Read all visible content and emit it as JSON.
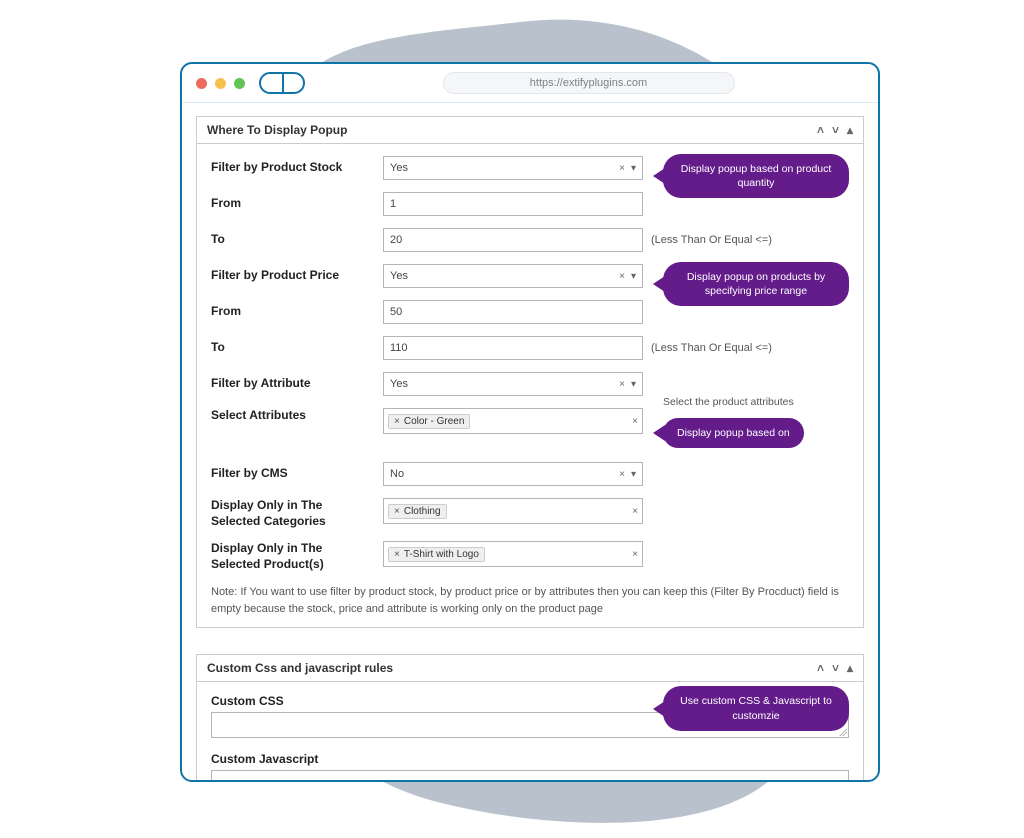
{
  "window": {
    "url": "https://extifyplugins.com"
  },
  "panel1": {
    "title": "Where To Display Popup",
    "rows": {
      "stock_filter": {
        "label": "Filter by Product Stock",
        "value": "Yes"
      },
      "stock_from": {
        "label": "From",
        "value": "1"
      },
      "stock_to": {
        "label": "To",
        "value": "20",
        "suffix": "(Less Than Or Equal <=)"
      },
      "price_filter": {
        "label": "Filter by Product Price",
        "value": "Yes"
      },
      "price_from": {
        "label": "From",
        "value": "50"
      },
      "price_to": {
        "label": "To",
        "value": "110",
        "suffix": "(Less Than Or Equal <=)"
      },
      "attr_filter": {
        "label": "Filter by Attribute",
        "value": "Yes"
      },
      "attr_select": {
        "label": "Select Attributes",
        "tag": "Color - Green",
        "side_hint": "Select the product attributes"
      },
      "cms_filter": {
        "label": "Filter by CMS",
        "value": "No"
      },
      "cat_only": {
        "label": "Display Only in The Selected Categories",
        "tag": "Clothing"
      },
      "prod_only": {
        "label": "Display Only in The Selected Product(s)",
        "tag": "T-Shirt with Logo"
      }
    },
    "note": "Note: If You want to use filter by product stock, by product price or by attributes then you can keep this (Filter By Procduct) field is empty because the stock, price and attribute is working only on the product page",
    "tooltips": {
      "t1": "Display popup based on product quantity",
      "t2": "Display popup on products by specifying price range",
      "t3": "Display popup based on",
      "t4": "Use custom CSS & Javascript to customzie"
    }
  },
  "panel2": {
    "title": "Custom Css and javascript rules",
    "css_label": "Custom CSS",
    "js_label": "Custom Javascript"
  }
}
